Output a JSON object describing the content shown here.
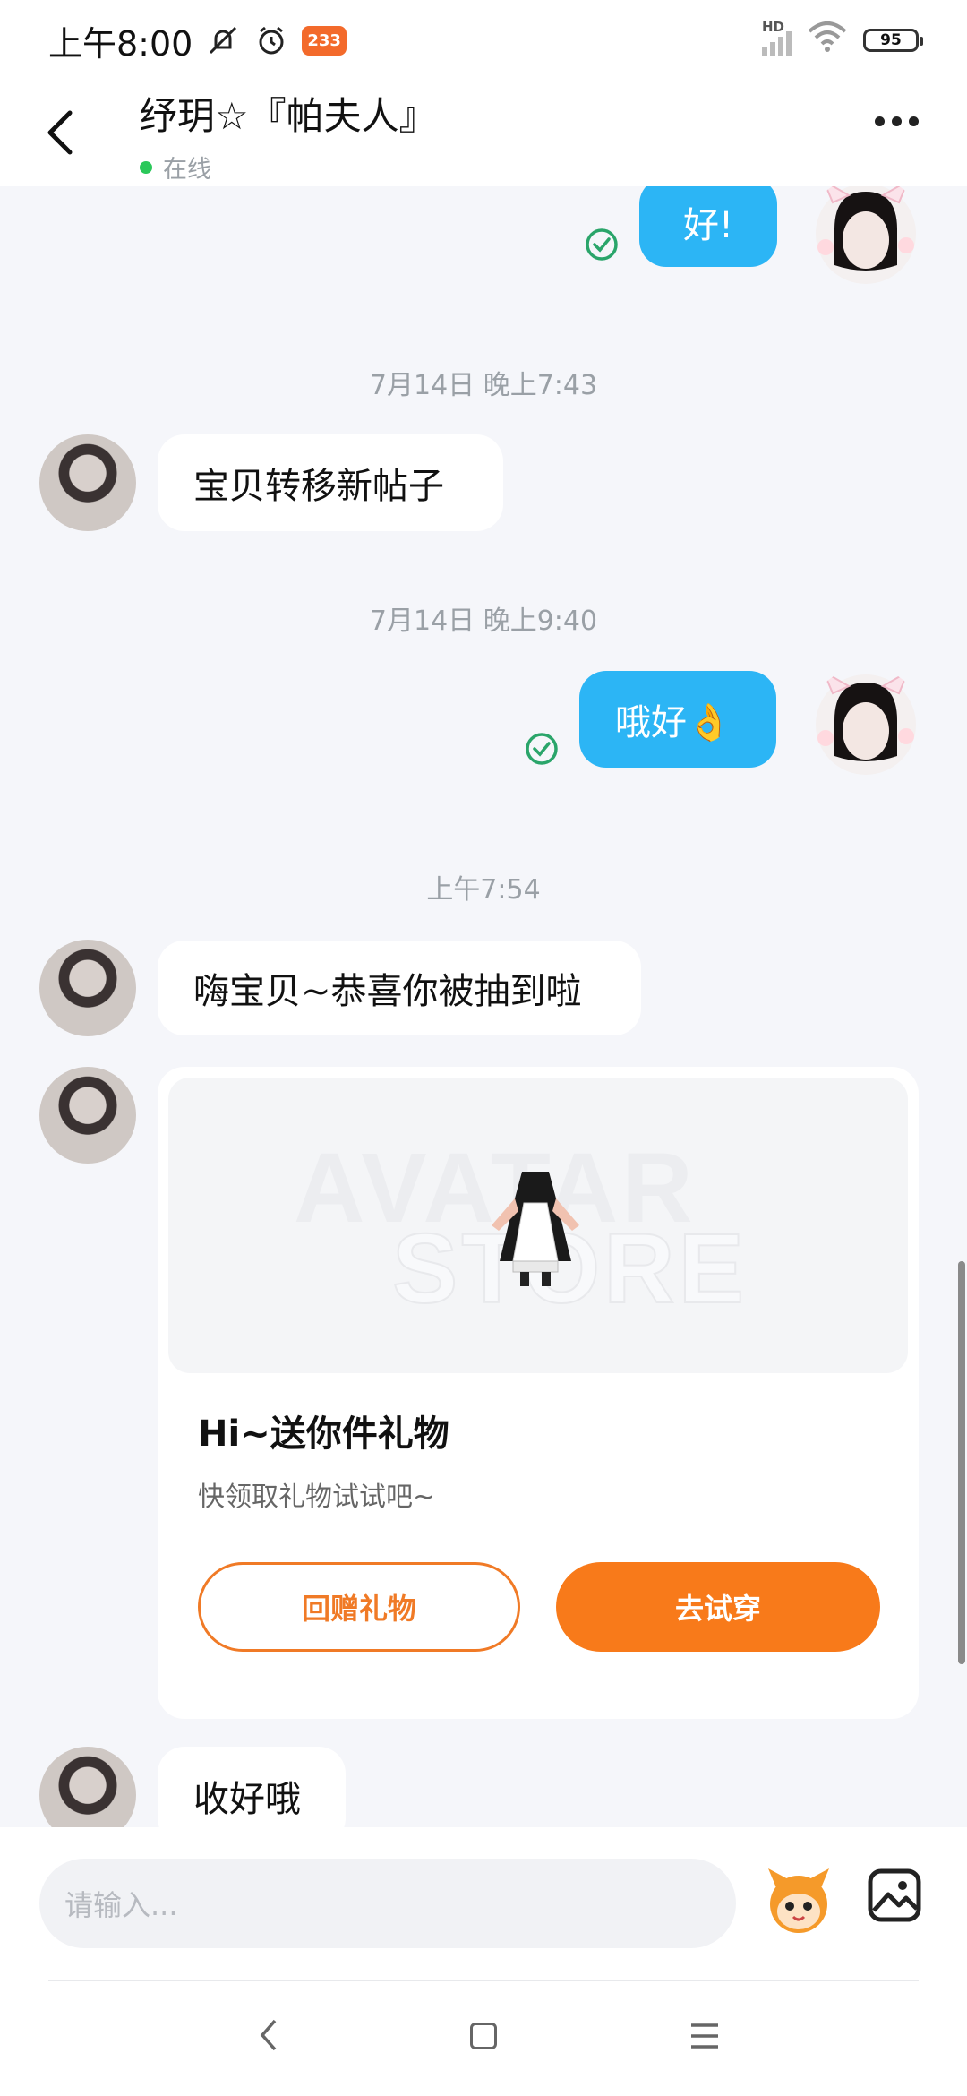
{
  "status_bar": {
    "time": "上午8:00",
    "badge": "233",
    "network": "HD",
    "battery": "95"
  },
  "header": {
    "title": "纾玥☆『帕夫人』",
    "status": "在线"
  },
  "messages": {
    "out1": "好!",
    "ts1": "7月14日 晚上7:43",
    "in1": "宝贝转移新帖子",
    "ts2": "7月14日 晚上9:40",
    "out2": "哦好👌",
    "ts3": "上午7:54",
    "in2": "嗨宝贝~恭喜你被抽到啦",
    "in3": "收好哦"
  },
  "gift_card": {
    "watermark_line1": "AVATAR",
    "watermark_line2": "STORE",
    "title": "Hi~送你件礼物",
    "subtitle": "快领取礼物试试吧~",
    "btn_return": "回赠礼物",
    "btn_try": "去试穿"
  },
  "input": {
    "placeholder": "请输入..."
  },
  "colors": {
    "accent_blue": "#2cb5f5",
    "accent_orange": "#f87a1a",
    "online_green": "#2bc85a"
  }
}
